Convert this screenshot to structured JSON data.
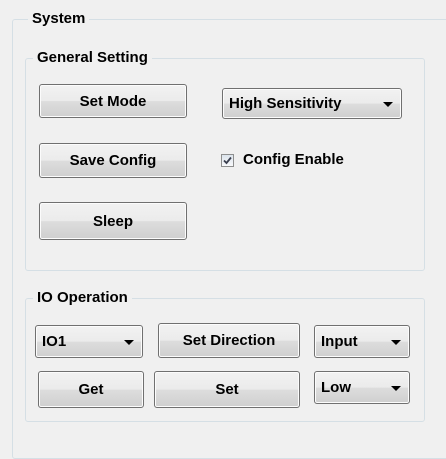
{
  "system": {
    "title": "System",
    "general": {
      "title": "General Setting",
      "set_mode_label": "Set Mode",
      "save_config_label": "Save Config",
      "sleep_label": "Sleep",
      "sensitivity_value": "High Sensitivity",
      "config_enable_label": "Config Enable",
      "config_enable_checked": true
    },
    "io": {
      "title": "IO Operation",
      "io_select_value": "IO1",
      "set_direction_label": "Set Direction",
      "direction_value": "Input",
      "get_label": "Get",
      "set_label": "Set",
      "level_value": "Low"
    }
  }
}
